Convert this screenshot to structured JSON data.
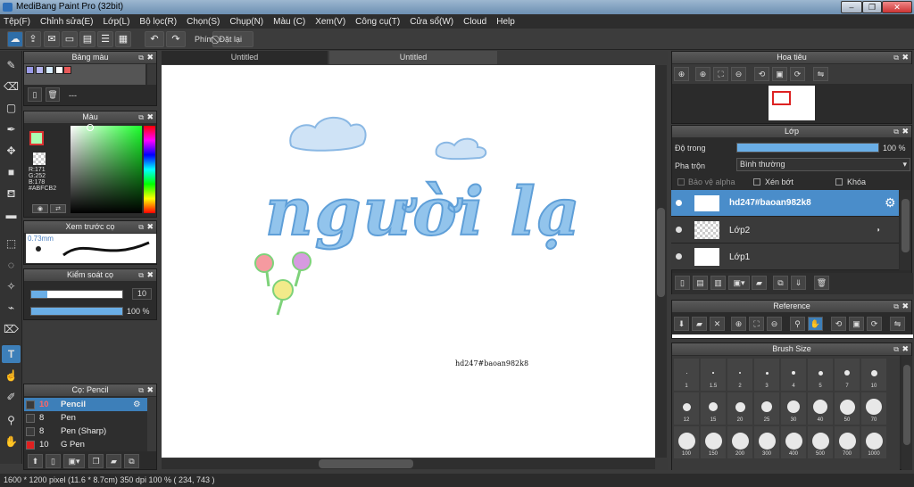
{
  "window": {
    "title": "MediBang Paint Pro (32bit)"
  },
  "menu": [
    "Tệp(F)",
    "Chỉnh sửa(E)",
    "Lớp(L)",
    "Bộ lọc(R)",
    "Chọn(S)",
    "Chụp(N)",
    "Màu (C)",
    "Xem(V)",
    "Công cụ(T)",
    "Cửa sổ(W)",
    "Cloud",
    "Help"
  ],
  "toolbar": {
    "shortcut_label": "Phím",
    "reset_label": "Đặt lại"
  },
  "palette": {
    "title": "Bảng màu",
    "set_name": "---",
    "swatches": [
      "#9b9be8",
      "#b7b7f0",
      "#d8ecff",
      "#ffffff",
      "#e85a5a"
    ]
  },
  "color": {
    "title": "Màu",
    "r": "R:171",
    "g": "G:252",
    "b": "B:178",
    "hex": "#ABFCB2",
    "main": "#ABFCB2"
  },
  "brush_preview": {
    "title": "Xem trước cọ",
    "size": "0.73mm"
  },
  "brush_control": {
    "title": "Kiểm soát cọ",
    "size_value": "10",
    "opacity_value": "100 %"
  },
  "brush_list": {
    "title": "Cọ: Pencil",
    "items": [
      {
        "size": "10",
        "name": "Pencil",
        "color": "#3a3a3a",
        "selected": true
      },
      {
        "size": "8",
        "name": "Pen",
        "color": "#3a3a3a",
        "selected": false
      },
      {
        "size": "8",
        "name": "Pen (Sharp)",
        "color": "#3a3a3a",
        "selected": false
      },
      {
        "size": "10",
        "name": "G Pen",
        "color": "#e02020",
        "selected": false
      }
    ]
  },
  "tabs": [
    "Untitled",
    "Untitled"
  ],
  "canvas": {
    "main_text": "người lạ",
    "watermark": "hd247#baoan982k8"
  },
  "navigator": {
    "title": "Hoa tiêu"
  },
  "layers": {
    "title": "Lớp",
    "opacity_label": "Độ trong",
    "opacity_value": "100 %",
    "opacity": 1.0,
    "blend_label": "Pha trộn",
    "blend_value": "Bình thường",
    "protect_alpha": "Bảo vệ alpha",
    "clipping": "Xén bớt",
    "lock": "Khóa",
    "items": [
      {
        "name": "hd247#baoan982k8",
        "selected": true
      },
      {
        "name": "Lớp2",
        "selected": false
      },
      {
        "name": "Lớp1",
        "selected": false
      }
    ]
  },
  "reference": {
    "title": "Reference"
  },
  "brush_size": {
    "title": "Brush Size",
    "sizes": [
      "1",
      "1.5",
      "2",
      "3",
      "4",
      "5",
      "7",
      "10",
      "12",
      "15",
      "20",
      "25",
      "30",
      "40",
      "50",
      "70",
      "100",
      "150",
      "200",
      "300",
      "400",
      "500",
      "700",
      "1000"
    ]
  },
  "status": "1600 * 1200 pixel  (11.6 * 8.7cm)  350 dpi  100 %  ( 234, 743 )"
}
